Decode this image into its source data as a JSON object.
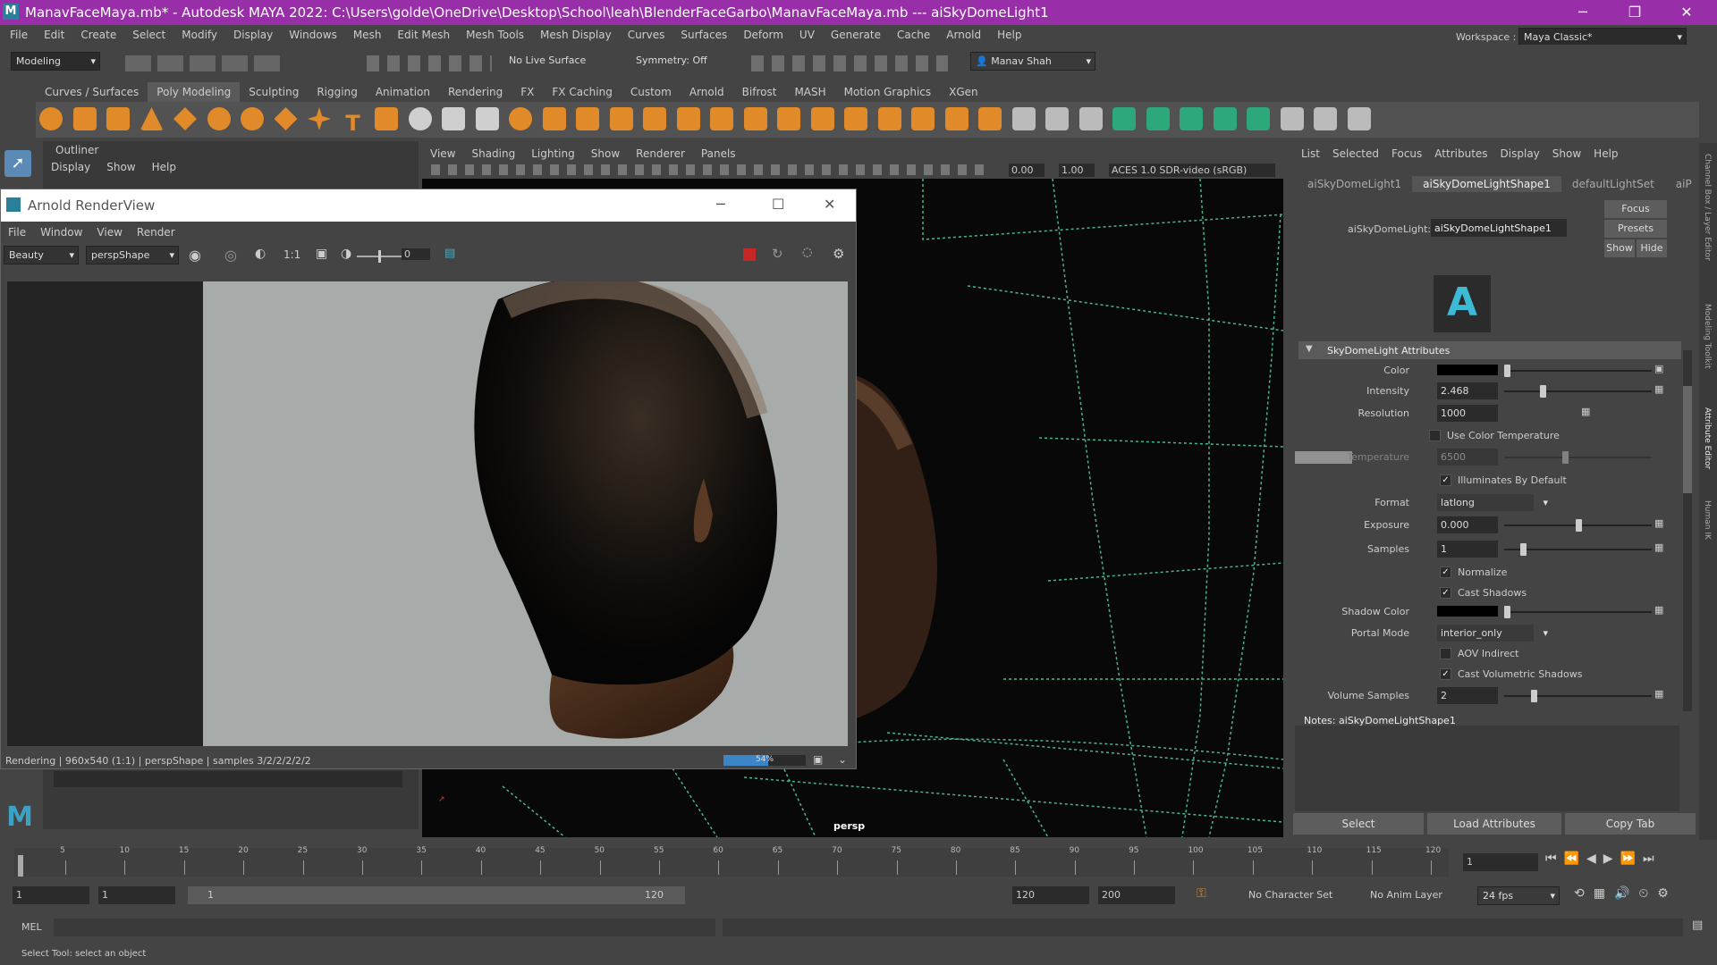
{
  "window": {
    "title": "ManavFaceMaya.mb* - Autodesk MAYA 2022: C:\\Users\\golde\\OneDrive\\Desktop\\School\\leah\\BlenderFaceGarbo\\ManavFaceMaya.mb   ---   aiSkyDomeLight1",
    "minimize": "─",
    "maximize": "❐",
    "close": "✕"
  },
  "menu": [
    "File",
    "Edit",
    "Create",
    "Select",
    "Modify",
    "Display",
    "Windows",
    "Mesh",
    "Edit Mesh",
    "Mesh Tools",
    "Mesh Display",
    "Curves",
    "Surfaces",
    "Deform",
    "UV",
    "Generate",
    "Cache",
    "Arnold",
    "Help"
  ],
  "workspace": {
    "label": "Workspace :",
    "value": "Maya Classic*"
  },
  "status": {
    "mode": "Modeling",
    "live_surface": "No Live Surface",
    "symmetry": "Symmetry: Off",
    "user": "Manav Shah"
  },
  "shelf_tabs": [
    "Curves / Surfaces",
    "Poly Modeling",
    "Sculpting",
    "Rigging",
    "Animation",
    "Rendering",
    "FX",
    "FX Caching",
    "Custom",
    "Arnold",
    "Bifrost",
    "MASH",
    "Motion Graphics",
    "XGen"
  ],
  "outliner": {
    "title": "Outliner",
    "menu": [
      "Display",
      "Show",
      "Help"
    ]
  },
  "viewport": {
    "menu": [
      "View",
      "Shading",
      "Lighting",
      "Show",
      "Renderer",
      "Panels"
    ],
    "exposure": "0.00",
    "gamma": "1.00",
    "color_space": "ACES 1.0 SDR-video (sRGB)",
    "camera": "persp"
  },
  "renderview": {
    "title": "Arnold RenderView",
    "menu": [
      "File",
      "Window",
      "View",
      "Render"
    ],
    "aov": "Beauty",
    "camera": "perspShape",
    "ratio": "1:1",
    "value": "0",
    "status": "Rendering | 960x540 (1:1) | perspShape | samples 3/2/2/2/2/2",
    "progress": "54%",
    "progress_value": 0.54
  },
  "ae": {
    "menu": [
      "List",
      "Selected",
      "Focus",
      "Attributes",
      "Display",
      "Show",
      "Help"
    ],
    "tabs": [
      "aiSkyDomeLight1",
      "aiSkyDomeLightShape1",
      "defaultLightSet",
      "aiP"
    ],
    "node_label": "aiSkyDomeLight:",
    "node_value": "aiSkyDomeLightShape1",
    "focus": "Focus",
    "presets": "Presets",
    "show": "Show",
    "hide": "Hide",
    "section": "SkyDomeLight Attributes",
    "attrs": {
      "color": "Color",
      "intensity_l": "Intensity",
      "intensity": "2.468",
      "resolution_l": "Resolution",
      "resolution": "1000",
      "use_color_temp": "Use Color Temperature",
      "temperature_l": "Temperature",
      "temperature": "6500",
      "illuminates": "Illuminates By Default",
      "format_l": "Format",
      "format": "latlong",
      "exposure_l": "Exposure",
      "exposure": "0.000",
      "samples_l": "Samples",
      "samples": "1",
      "normalize": "Normalize",
      "cast_shadows": "Cast Shadows",
      "shadow_color": "Shadow Color",
      "portal_l": "Portal Mode",
      "portal": "interior_only",
      "aov_indirect": "AOV Indirect",
      "cast_vol": "Cast Volumetric Shadows",
      "vol_samples_l": "Volume Samples",
      "vol_samples": "2"
    },
    "notes": "Notes:  aiSkyDomeLightShape1",
    "buttons": [
      "Select",
      "Load Attributes",
      "Copy Tab"
    ],
    "side_tabs": [
      "Channel Box / Layer Editor",
      "Modeling Toolkit",
      "Attribute Editor",
      "Human IK"
    ]
  },
  "timeline": {
    "ticks": [
      "5",
      "10",
      "15",
      "20",
      "25",
      "30",
      "35",
      "40",
      "45",
      "50",
      "55",
      "60",
      "65",
      "70",
      "75",
      "80",
      "85",
      "90",
      "95",
      "100",
      "105",
      "110",
      "115",
      "120"
    ],
    "current_frame": "1",
    "frame_start": "1"
  },
  "range": {
    "start": "1",
    "inner_start": "1",
    "slider_start": "1",
    "slider_end": "120",
    "end": "120",
    "total_end": "200",
    "char_set": "No Character Set",
    "anim_layer": "No Anim Layer",
    "fps": "24 fps"
  },
  "mel": {
    "label": "MEL"
  },
  "help": "Select Tool: select an object"
}
